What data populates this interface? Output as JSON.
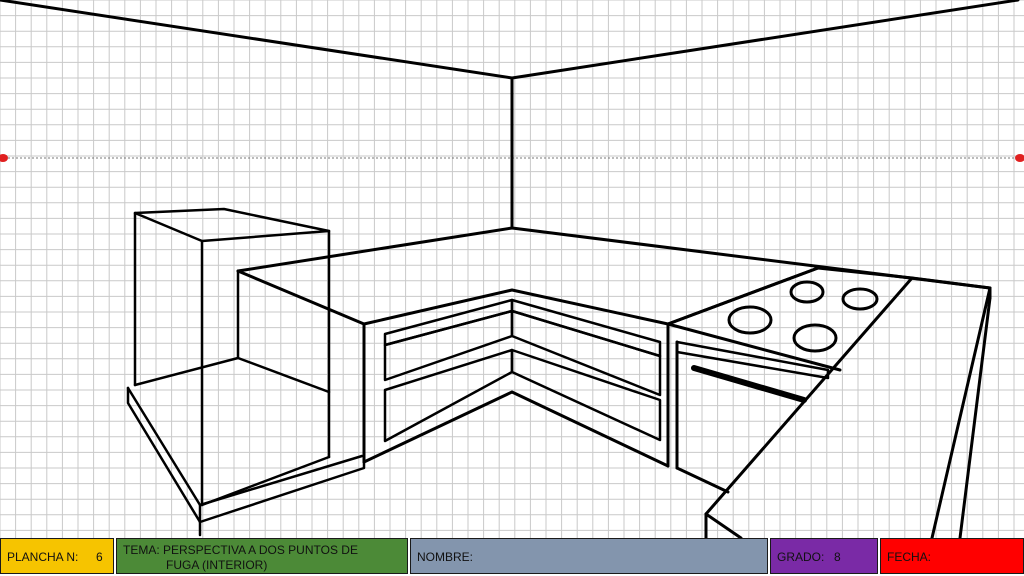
{
  "drawing": {
    "grid_visible": true,
    "horizon_line_style": "dotted",
    "vanishing_point_color": "#e02020"
  },
  "footer": {
    "plancha": {
      "label": "PLANCHA N:",
      "value": "6",
      "color": "#f6c400"
    },
    "tema": {
      "line1": "TEMA: PERSPECTIVA A DOS PUNTOS DE",
      "line2": "FUGA (INTERIOR)",
      "color": "#4c8a37"
    },
    "nombre": {
      "label": "NOMBRE:",
      "value": "",
      "color": "#8395ad"
    },
    "grado": {
      "label": "GRADO:",
      "value": "8",
      "color": "#7a2aa6"
    },
    "fecha": {
      "label": "FECHA:",
      "value": "",
      "color": "#ff0000"
    }
  }
}
